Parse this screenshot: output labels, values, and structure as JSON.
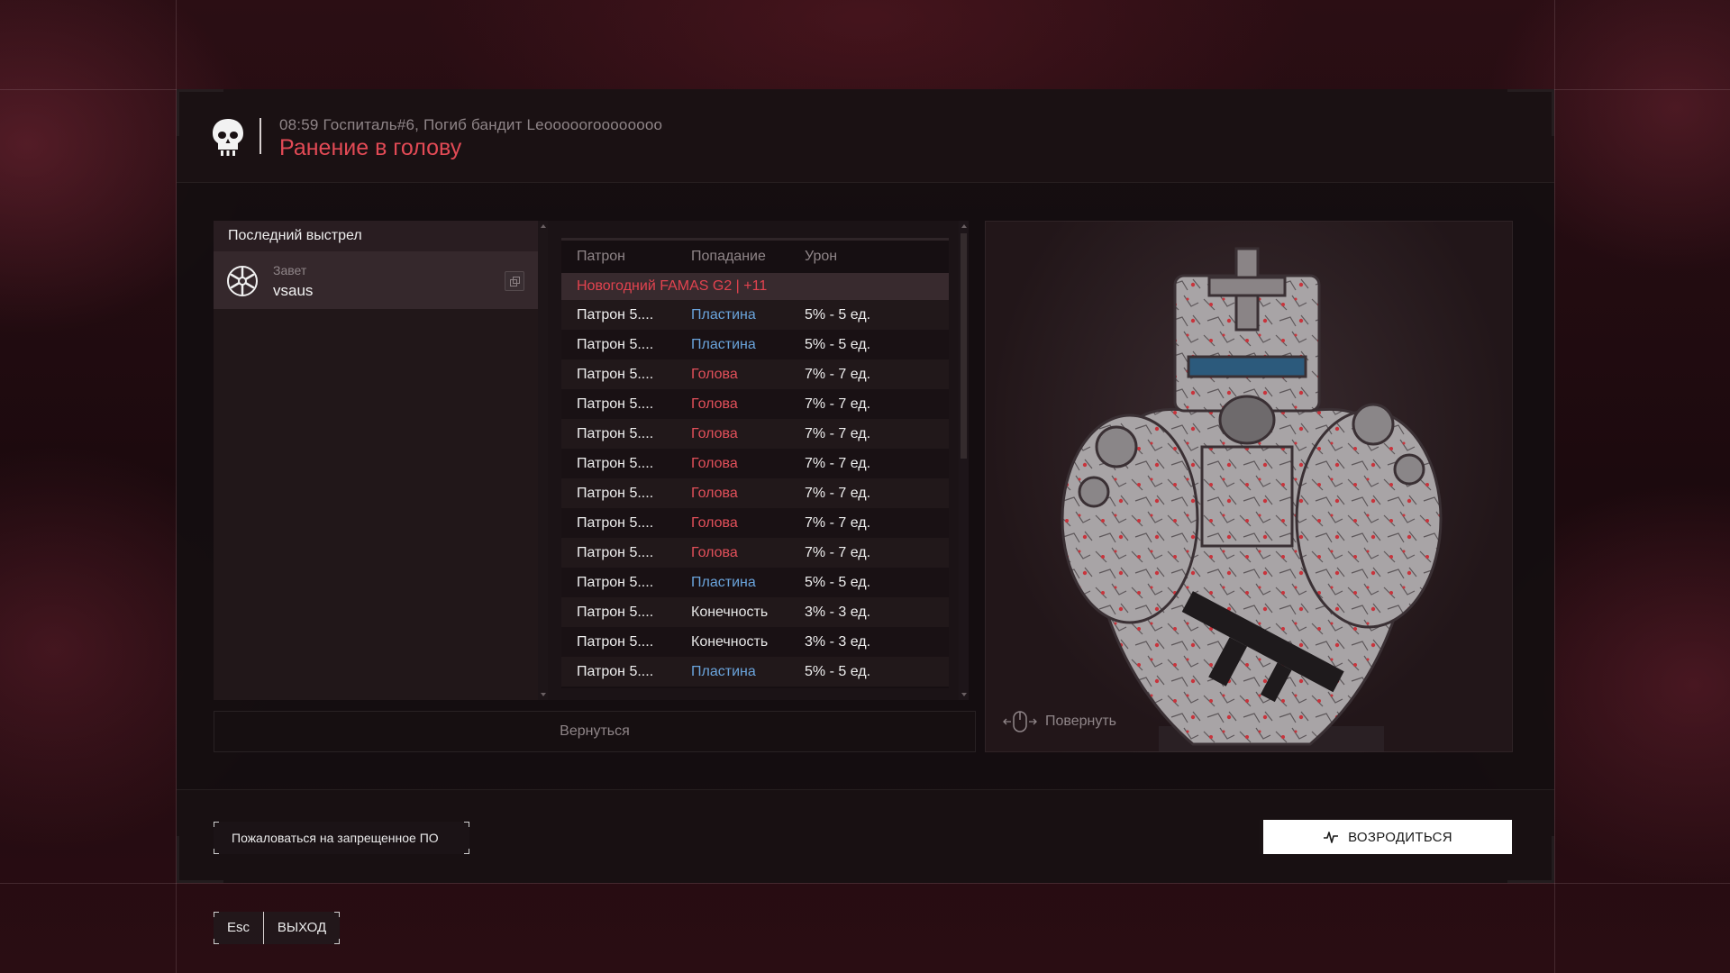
{
  "header": {
    "subtitle": "08:59 Госпиталь#6, Погиб бандит Leoooooroooooooo",
    "title": "Ранение в голову"
  },
  "last_shot": {
    "heading": "Последний выстрел",
    "role": "Завет",
    "name": "vsaus"
  },
  "table": {
    "columns": [
      "Патрон",
      "Попадание",
      "Урон"
    ],
    "weapon": "Новогодний FAMAS G2 | +11",
    "rows": [
      {
        "ammo": "Патрон 5....",
        "hit": "Пластина",
        "damage": "5% - 5 ед.",
        "type": "plate"
      },
      {
        "ammo": "Патрон 5....",
        "hit": "Пластина",
        "damage": "5% - 5 ед.",
        "type": "plate"
      },
      {
        "ammo": "Патрон 5....",
        "hit": "Голова",
        "damage": "7% - 7 ед.",
        "type": "head"
      },
      {
        "ammo": "Патрон 5....",
        "hit": "Голова",
        "damage": "7% - 7 ед.",
        "type": "head"
      },
      {
        "ammo": "Патрон 5....",
        "hit": "Голова",
        "damage": "7% - 7 ед.",
        "type": "head"
      },
      {
        "ammo": "Патрон 5....",
        "hit": "Голова",
        "damage": "7% - 7 ед.",
        "type": "head"
      },
      {
        "ammo": "Патрон 5....",
        "hit": "Голова",
        "damage": "7% - 7 ед.",
        "type": "head"
      },
      {
        "ammo": "Патрон 5....",
        "hit": "Голова",
        "damage": "7% - 7 ед.",
        "type": "head"
      },
      {
        "ammo": "Патрон 5....",
        "hit": "Голова",
        "damage": "7% - 7 ед.",
        "type": "head"
      },
      {
        "ammo": "Патрон 5....",
        "hit": "Пластина",
        "damage": "5% - 5 ед.",
        "type": "plate"
      },
      {
        "ammo": "Патрон 5....",
        "hit": "Конечность",
        "damage": "3% - 3 ед.",
        "type": "limb"
      },
      {
        "ammo": "Патрон 5....",
        "hit": "Конечность",
        "damage": "3% - 3 ед.",
        "type": "limb"
      },
      {
        "ammo": "Патрон 5....",
        "hit": "Пластина",
        "damage": "5% - 5 ед.",
        "type": "plate"
      }
    ]
  },
  "back_label": "Вернуться",
  "preview": {
    "rotate_label": "Повернуть"
  },
  "footer": {
    "report_label": "Пожаловаться на запрещенное ПО",
    "respawn_label": "ВОЗРОДИТЬСЯ"
  },
  "exit": {
    "key": "Esc",
    "label": "ВЫХОД"
  },
  "colors": {
    "accent_red": "#e24a55",
    "plate_blue": "#6aa4dc"
  },
  "icons": [
    "skull-icon",
    "clan-emblem-icon",
    "copy-icon",
    "mouse-rotate-icon",
    "pulse-icon"
  ]
}
